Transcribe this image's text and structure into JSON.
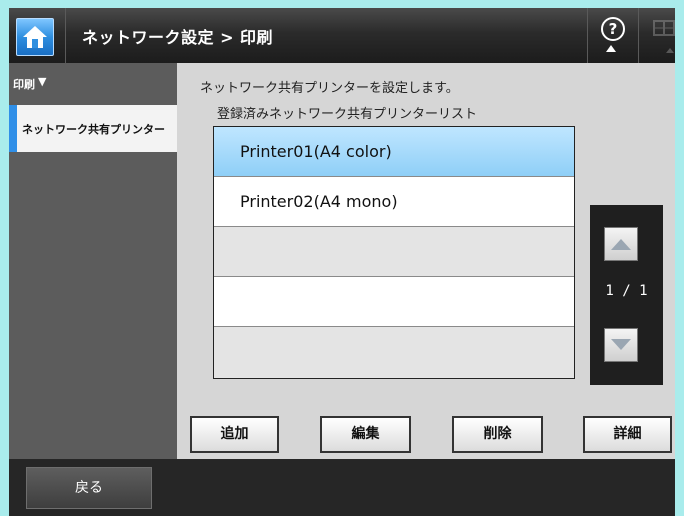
{
  "header": {
    "title": "ネットワーク設定 > 印刷",
    "home_icon": "home-icon",
    "help_icon": "help-icon",
    "keyboard_icon": "keyboard-icon"
  },
  "sidebar": {
    "category": "印刷",
    "category_arrow": "▼",
    "items": [
      {
        "label": "ネットワーク共有プリンター",
        "selected": true
      }
    ]
  },
  "main": {
    "description": "ネットワーク共有プリンターを設定します。",
    "list_title": "登録済みネットワーク共有プリンターリスト",
    "printers": [
      {
        "name": "Printer01(A4 color)",
        "selected": true
      },
      {
        "name": "Printer02(A4 mono)",
        "selected": false
      }
    ],
    "pager": {
      "text": "1 / 1"
    },
    "buttons": {
      "add": "追加",
      "edit": "編集",
      "delete": "削除",
      "details": "詳細"
    }
  },
  "footer": {
    "back_label": "戻る"
  },
  "colors": {
    "accent": "#2f8fe8",
    "selected_row": "#a9dcfb",
    "background": "#a9ecec"
  }
}
